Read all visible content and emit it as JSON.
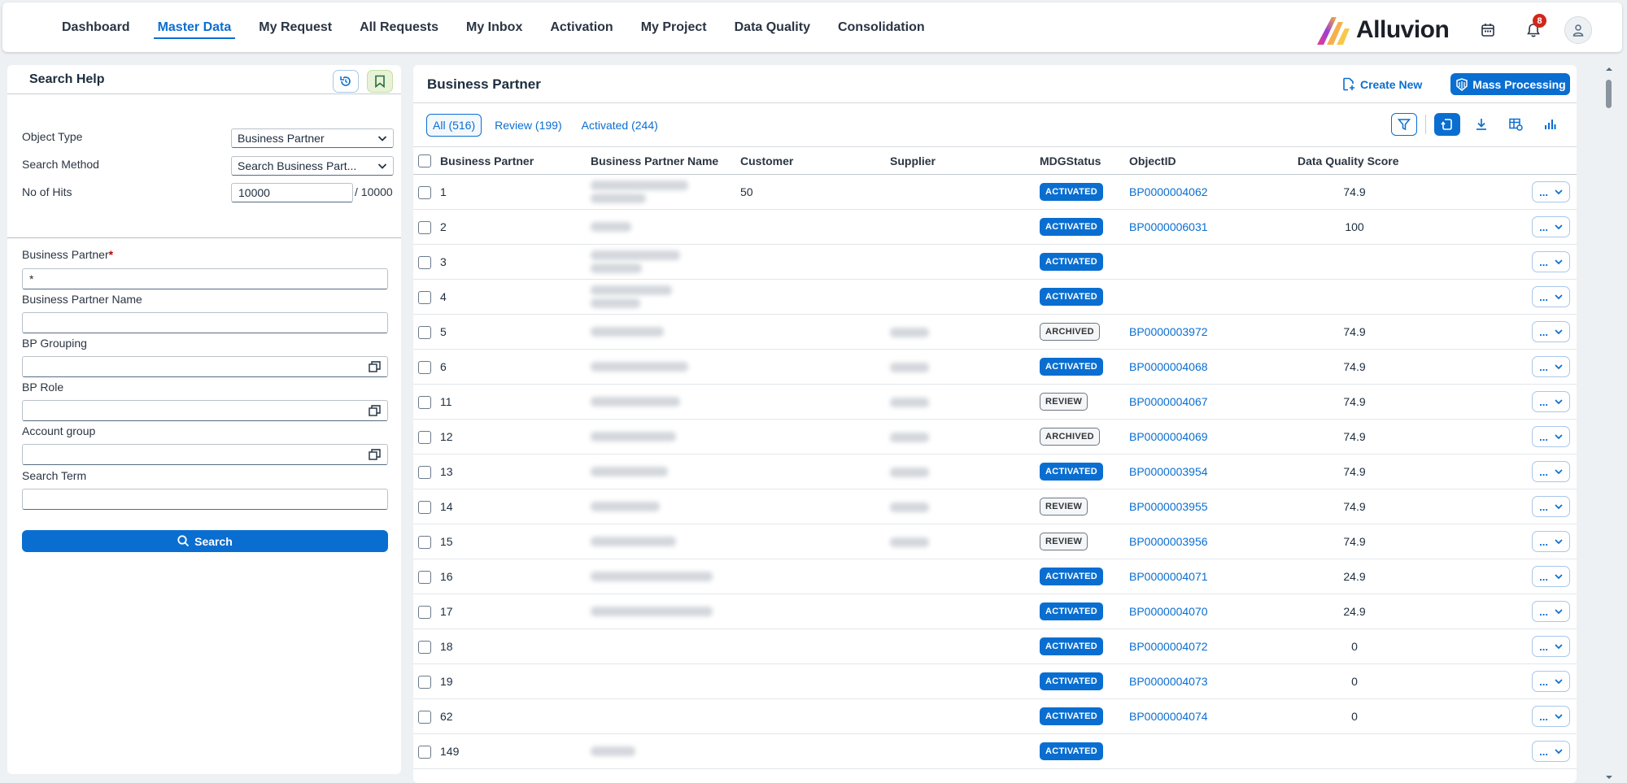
{
  "nav": {
    "items": [
      {
        "label": "Dashboard",
        "active": false
      },
      {
        "label": "Master Data",
        "active": true
      },
      {
        "label": "My Request",
        "active": false
      },
      {
        "label": "All Requests",
        "active": false
      },
      {
        "label": "My Inbox",
        "active": false
      },
      {
        "label": "Activation",
        "active": false
      },
      {
        "label": "My Project",
        "active": false
      },
      {
        "label": "Data Quality",
        "active": false
      },
      {
        "label": "Consolidation",
        "active": false
      }
    ],
    "brand": "Alluvion",
    "notification_count": "8",
    "icons": [
      "calendar-icon",
      "bell-icon",
      "user-icon"
    ]
  },
  "search_help": {
    "title": "Search Help",
    "object_type_label": "Object Type",
    "object_type_value": "Business Partner",
    "search_method_label": "Search Method",
    "search_method_value": "Search Business Part...",
    "hits_label": "No of Hits",
    "hits_value": "10000",
    "hits_max": "/ 10000",
    "bp_label": "Business Partner",
    "bp_required": "*",
    "bp_value": "*",
    "bp_name_label": "Business Partner Name",
    "bp_grouping_label": "BP Grouping",
    "bp_role_label": "BP Role",
    "account_group_label": "Account group",
    "search_term_label": "Search Term",
    "search_button": "Search"
  },
  "main": {
    "title": "Business Partner",
    "create_new": "Create New",
    "mass_processing": "Mass Processing",
    "tabs": [
      {
        "label": "All (516)",
        "active": true
      },
      {
        "label": "Review (199)",
        "active": false
      },
      {
        "label": "Activated (244)",
        "active": false
      }
    ],
    "columns": {
      "bp": "Business Partner",
      "name": "Business Partner Name",
      "customer": "Customer",
      "supplier": "Supplier",
      "status": "MDGStatus",
      "objectid": "ObjectID",
      "dq": "Data Quality Score"
    },
    "action_label": "...",
    "rows": [
      {
        "bp": "1",
        "customer": "50",
        "status": "ACTIVATED",
        "objectid": "BP0000004062",
        "dq": "74.9"
      },
      {
        "bp": "2",
        "customer": "",
        "status": "ACTIVATED",
        "objectid": "BP0000006031",
        "dq": "100"
      },
      {
        "bp": "3",
        "customer": "",
        "status": "ACTIVATED",
        "objectid": "",
        "dq": ""
      },
      {
        "bp": "4",
        "customer": "",
        "status": "ACTIVATED",
        "objectid": "",
        "dq": ""
      },
      {
        "bp": "5",
        "customer": "",
        "status": "ARCHIVED",
        "objectid": "BP0000003972",
        "dq": "74.9"
      },
      {
        "bp": "6",
        "customer": "",
        "status": "ACTIVATED",
        "objectid": "BP0000004068",
        "dq": "74.9"
      },
      {
        "bp": "11",
        "customer": "",
        "status": "REVIEW",
        "objectid": "BP0000004067",
        "dq": "74.9"
      },
      {
        "bp": "12",
        "customer": "",
        "status": "ARCHIVED",
        "objectid": "BP0000004069",
        "dq": "74.9"
      },
      {
        "bp": "13",
        "customer": "",
        "status": "ACTIVATED",
        "objectid": "BP0000003954",
        "dq": "74.9"
      },
      {
        "bp": "14",
        "customer": "",
        "status": "REVIEW",
        "objectid": "BP0000003955",
        "dq": "74.9"
      },
      {
        "bp": "15",
        "customer": "",
        "status": "REVIEW",
        "objectid": "BP0000003956",
        "dq": "74.9"
      },
      {
        "bp": "16",
        "customer": "",
        "status": "ACTIVATED",
        "objectid": "BP0000004071",
        "dq": "24.9"
      },
      {
        "bp": "17",
        "customer": "",
        "status": "ACTIVATED",
        "objectid": "BP0000004070",
        "dq": "24.9"
      },
      {
        "bp": "18",
        "customer": "",
        "status": "ACTIVATED",
        "objectid": "BP0000004072",
        "dq": "0"
      },
      {
        "bp": "19",
        "customer": "",
        "status": "ACTIVATED",
        "objectid": "BP0000004073",
        "dq": "0"
      },
      {
        "bp": "62",
        "customer": "",
        "status": "ACTIVATED",
        "objectid": "BP0000004074",
        "dq": "0"
      },
      {
        "bp": "149",
        "customer": "",
        "status": "ACTIVATED",
        "objectid": "",
        "dq": ""
      }
    ]
  }
}
